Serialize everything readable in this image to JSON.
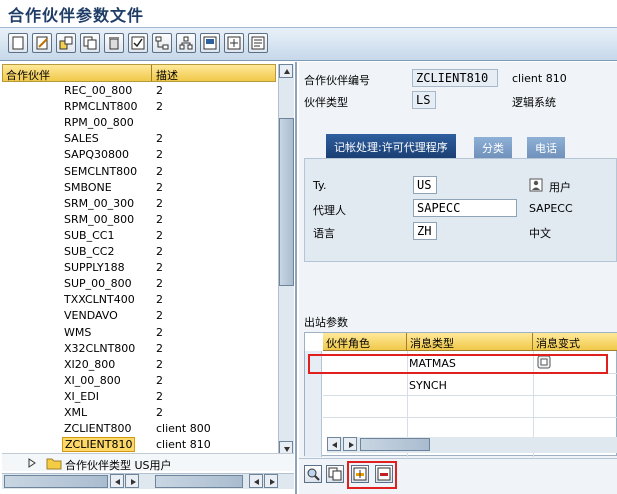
{
  "title": "合作伙伴参数文件",
  "toolbar": {
    "buttons": [
      "new-icon",
      "edit-icon",
      "save-variant-icon",
      "copy-icon",
      "delete-icon",
      "check-icon",
      "hierarchy-icon",
      "structure-icon",
      "display-icon",
      "add-icon",
      "print-icon"
    ]
  },
  "tree": {
    "col_partner": "合作伙伴",
    "col_desc": "描述",
    "rows": [
      {
        "name": "REC_00_800",
        "desc": "2"
      },
      {
        "name": "RPMCLNT800",
        "desc": "2"
      },
      {
        "name": "RPM_00_800",
        "desc": ""
      },
      {
        "name": "SALES",
        "desc": "2"
      },
      {
        "name": "SAPQ30800",
        "desc": "2"
      },
      {
        "name": "SEMCLNT800",
        "desc": "2"
      },
      {
        "name": "SMBONE",
        "desc": "2"
      },
      {
        "name": "SRM_00_300",
        "desc": "2"
      },
      {
        "name": "SRM_00_800",
        "desc": "2"
      },
      {
        "name": "SUB_CC1",
        "desc": "2"
      },
      {
        "name": "SUB_CC2",
        "desc": "2"
      },
      {
        "name": "SUPPLY188",
        "desc": "2"
      },
      {
        "name": "SUP_00_800",
        "desc": "2"
      },
      {
        "name": "TXXCLNT400",
        "desc": "2"
      },
      {
        "name": "VENDAVO",
        "desc": "2"
      },
      {
        "name": "WMS",
        "desc": "2"
      },
      {
        "name": "X32CLNT800",
        "desc": "2"
      },
      {
        "name": "XI20_800",
        "desc": "2"
      },
      {
        "name": "XI_00_800",
        "desc": "2"
      },
      {
        "name": "XI_EDI",
        "desc": "2"
      },
      {
        "name": "XML",
        "desc": "2"
      },
      {
        "name": "ZCLIENT800",
        "desc": "client 800"
      },
      {
        "name": "ZCLIENT810",
        "desc": "client 810"
      }
    ],
    "folder_label": "合作伙伴类型 US用户"
  },
  "header": {
    "partner_no_label": "合作伙伴编号",
    "partner_no_value": "ZCLIENT810",
    "partner_no_desc": "client 810",
    "partner_type_label": "伙伴类型",
    "partner_type_value": "LS",
    "partner_type_desc": "逻辑系统"
  },
  "tabs": [
    "记帐处理:许可代理程序",
    "分类",
    "电话"
  ],
  "tab_content": {
    "ty_label": "Ty.",
    "ty_value": "US",
    "ty_desc": "用户",
    "agent_label": "代理人",
    "agent_value": "SAPECC",
    "agent_desc": "SAPECC",
    "lang_label": "语言",
    "lang_value": "ZH",
    "lang_desc": "中文"
  },
  "outbound": {
    "label": "出站参数",
    "headers": [
      "伙伴角色",
      "消息类型",
      "消息变式"
    ],
    "rows": [
      {
        "role": "",
        "msgtype": "MATMAS",
        "variant": ""
      },
      {
        "role": "",
        "msgtype": "SYNCH",
        "variant": ""
      }
    ]
  },
  "colors": {
    "highlight_red": "#e0201e",
    "tab_active": "#1b3f73",
    "header_yellow": "#f0c94a"
  }
}
